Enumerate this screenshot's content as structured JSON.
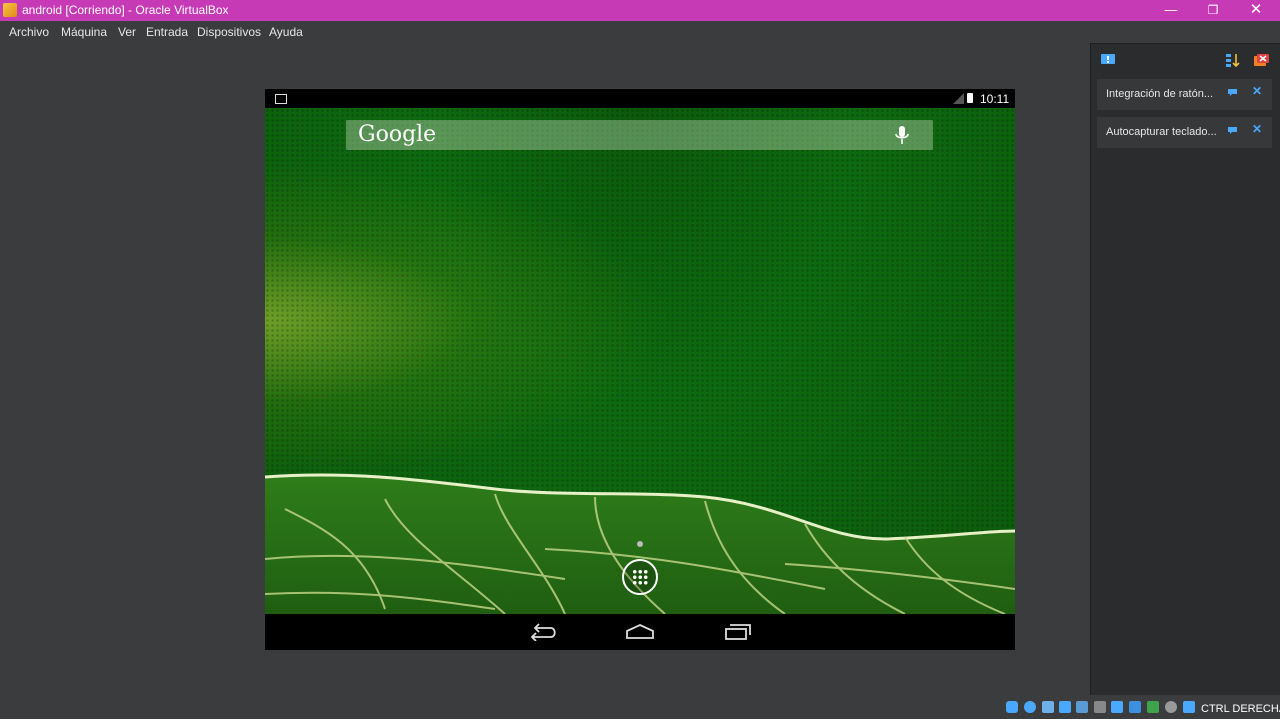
{
  "window": {
    "title": "android [Corriendo] - Oracle VirtualBox",
    "minimize_label": "—",
    "maximize_label": "❐",
    "close_label": "✕"
  },
  "menu": {
    "items": [
      {
        "label": "Archivo"
      },
      {
        "label": "Máquina"
      },
      {
        "label": "Ver"
      },
      {
        "label": "Entrada"
      },
      {
        "label": "Dispositivos"
      },
      {
        "label": "Ayuda"
      }
    ]
  },
  "guest": {
    "status_time": "10:11",
    "search_logo": "Google"
  },
  "notifications": [
    {
      "label": "Integración de ratón..."
    },
    {
      "label": "Autocapturar teclado..."
    }
  ],
  "statusbar": {
    "host_key": "CTRL DERECHA",
    "icons": [
      "hard-disk-icon",
      "optical-disk-icon",
      "audio-icon",
      "network-icon",
      "usb-icon",
      "shared-folder-icon",
      "display-icon",
      "video-capture-icon",
      "virtualization-icon",
      "mouse-integration-icon",
      "keyboard-capture-icon"
    ]
  },
  "colors": {
    "titlebar": "#c63bb5",
    "background": "#3b3c3e",
    "accent": "#4aa8ff"
  }
}
